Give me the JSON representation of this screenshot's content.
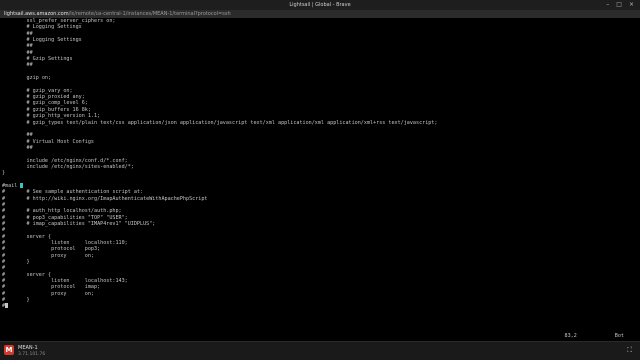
{
  "window": {
    "title": "Lightsail | Global - Brave"
  },
  "browser": {
    "url_host": "lightsail.aws.amazon.com",
    "url_path": "/ls/remote/us-central-1/instances/MEAN-1/terminal?protocol=ssh"
  },
  "terminal": {
    "lines_before_mail": "        ssl_prefer_server_ciphers on;\n        # Logging Settings\n        ##\n        # Logging Settings\n        ##\n        ##\n        # Gzip Settings\n        ##\n\n        gzip on;\n\n        # gzip_vary on;\n        # gzip_proxied any;\n        # gzip_comp_level 6;\n        # gzip_buffers 16 8k;\n        # gzip_http_version 1.1;\n        # gzip_types text/plain text/css application/json application/javascript text/xml application/xml application/xml+rss text/javascript;\n\n        ##\n        # Virtual Host Configs\n        ##\n\n        include /etc/nginx/conf.d/*.conf;\n        include /etc/nginx/sites-enabled/*;\n}\n\n",
    "mail_line": "#mail ",
    "lines_after_mail": "#       # See sample authentication script at:\n#       # http://wiki.nginx.org/ImapAuthenticateWithApachePhpScript\n#\n#       # auth_http localhost/auth.php;\n#       # pop3_capabilities \"TOP\" \"USER\";\n#       # imap_capabilities \"IMAP4rev1\" \"UIDPLUS\";\n#\n#       server {\n#               listen     localhost:110;\n#               protocol   pop3;\n#               proxy      on;\n#       }\n#\n#       server {\n#               listen     localhost:143;\n#               protocol   imap;\n#               proxy      on;\n#       }\n",
    "last_line": "#"
  },
  "vim_status": {
    "position": "83,2",
    "scroll": "Bot"
  },
  "taskbar": {
    "instance_name": "MEAN-1",
    "instance_ip": "3.71.101.76",
    "logo_letter": "M"
  }
}
